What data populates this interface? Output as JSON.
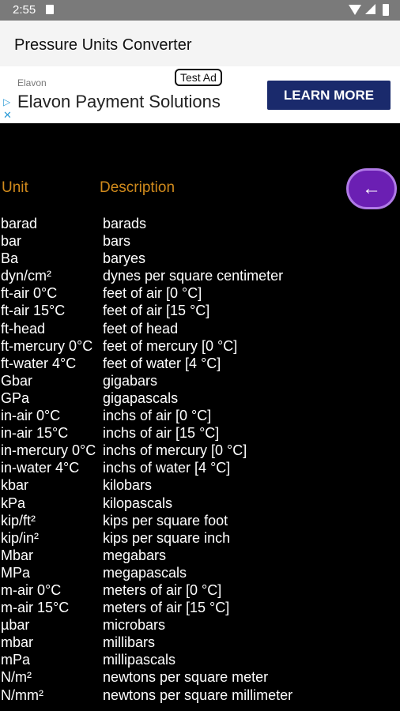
{
  "status_bar": {
    "time": "2:55"
  },
  "app_bar": {
    "title": "Pressure Units Converter"
  },
  "ad": {
    "badge": "Test Ad",
    "brand": "Elavon",
    "headline": "Elavon Payment Solutions",
    "cta": "LEARN MORE",
    "adchoices_icon": "adchoices-icon",
    "close_icon": "close-icon"
  },
  "table": {
    "headers": {
      "unit": "Unit",
      "description": "Description"
    },
    "header_color": "#d08a1c",
    "rows": [
      {
        "unit": "barad",
        "description": "barads"
      },
      {
        "unit": "bar",
        "description": "bars"
      },
      {
        "unit": "Ba",
        "description": "baryes"
      },
      {
        "unit": "dyn/cm²",
        "description": "dynes per square centimeter"
      },
      {
        "unit": "ft-air 0°C",
        "description": "feet of air [0 °C]"
      },
      {
        "unit": "ft-air 15°C",
        "description": "feet of air [15 °C]"
      },
      {
        "unit": "ft-head",
        "description": "feet of head"
      },
      {
        "unit": "ft-mercury 0°C",
        "description": "feet of mercury [0 °C]"
      },
      {
        "unit": "ft-water 4°C",
        "description": "feet of water [4 °C]"
      },
      {
        "unit": "Gbar",
        "description": "gigabars"
      },
      {
        "unit": "GPa",
        "description": "gigapascals"
      },
      {
        "unit": "in-air 0°C",
        "description": "inchs of air [0 °C]"
      },
      {
        "unit": "in-air 15°C",
        "description": "inchs of air [15 °C]"
      },
      {
        "unit": "in-mercury 0°C",
        "description": "inchs of mercury [0 °C]"
      },
      {
        "unit": "in-water 4°C",
        "description": "inchs of water [4 °C]"
      },
      {
        "unit": "kbar",
        "description": "kilobars"
      },
      {
        "unit": "kPa",
        "description": "kilopascals"
      },
      {
        "unit": "kip/ft²",
        "description": "kips per square foot"
      },
      {
        "unit": "kip/in²",
        "description": "kips per square inch"
      },
      {
        "unit": "Mbar",
        "description": "megabars"
      },
      {
        "unit": "MPa",
        "description": "megapascals"
      },
      {
        "unit": "m-air 0°C",
        "description": "meters of air [0 °C]"
      },
      {
        "unit": "m-air 15°C",
        "description": "meters of air [15 °C]"
      },
      {
        "unit": "µbar",
        "description": "microbars"
      },
      {
        "unit": "mbar",
        "description": "millibars"
      },
      {
        "unit": "mPa",
        "description": "millipascals"
      },
      {
        "unit": "N/m²",
        "description": "newtons per square meter"
      },
      {
        "unit": "N/mm²",
        "description": "newtons per square millimeter"
      }
    ]
  },
  "back_button": {
    "icon": "arrow-left-icon",
    "color": "#6b1fb3"
  }
}
